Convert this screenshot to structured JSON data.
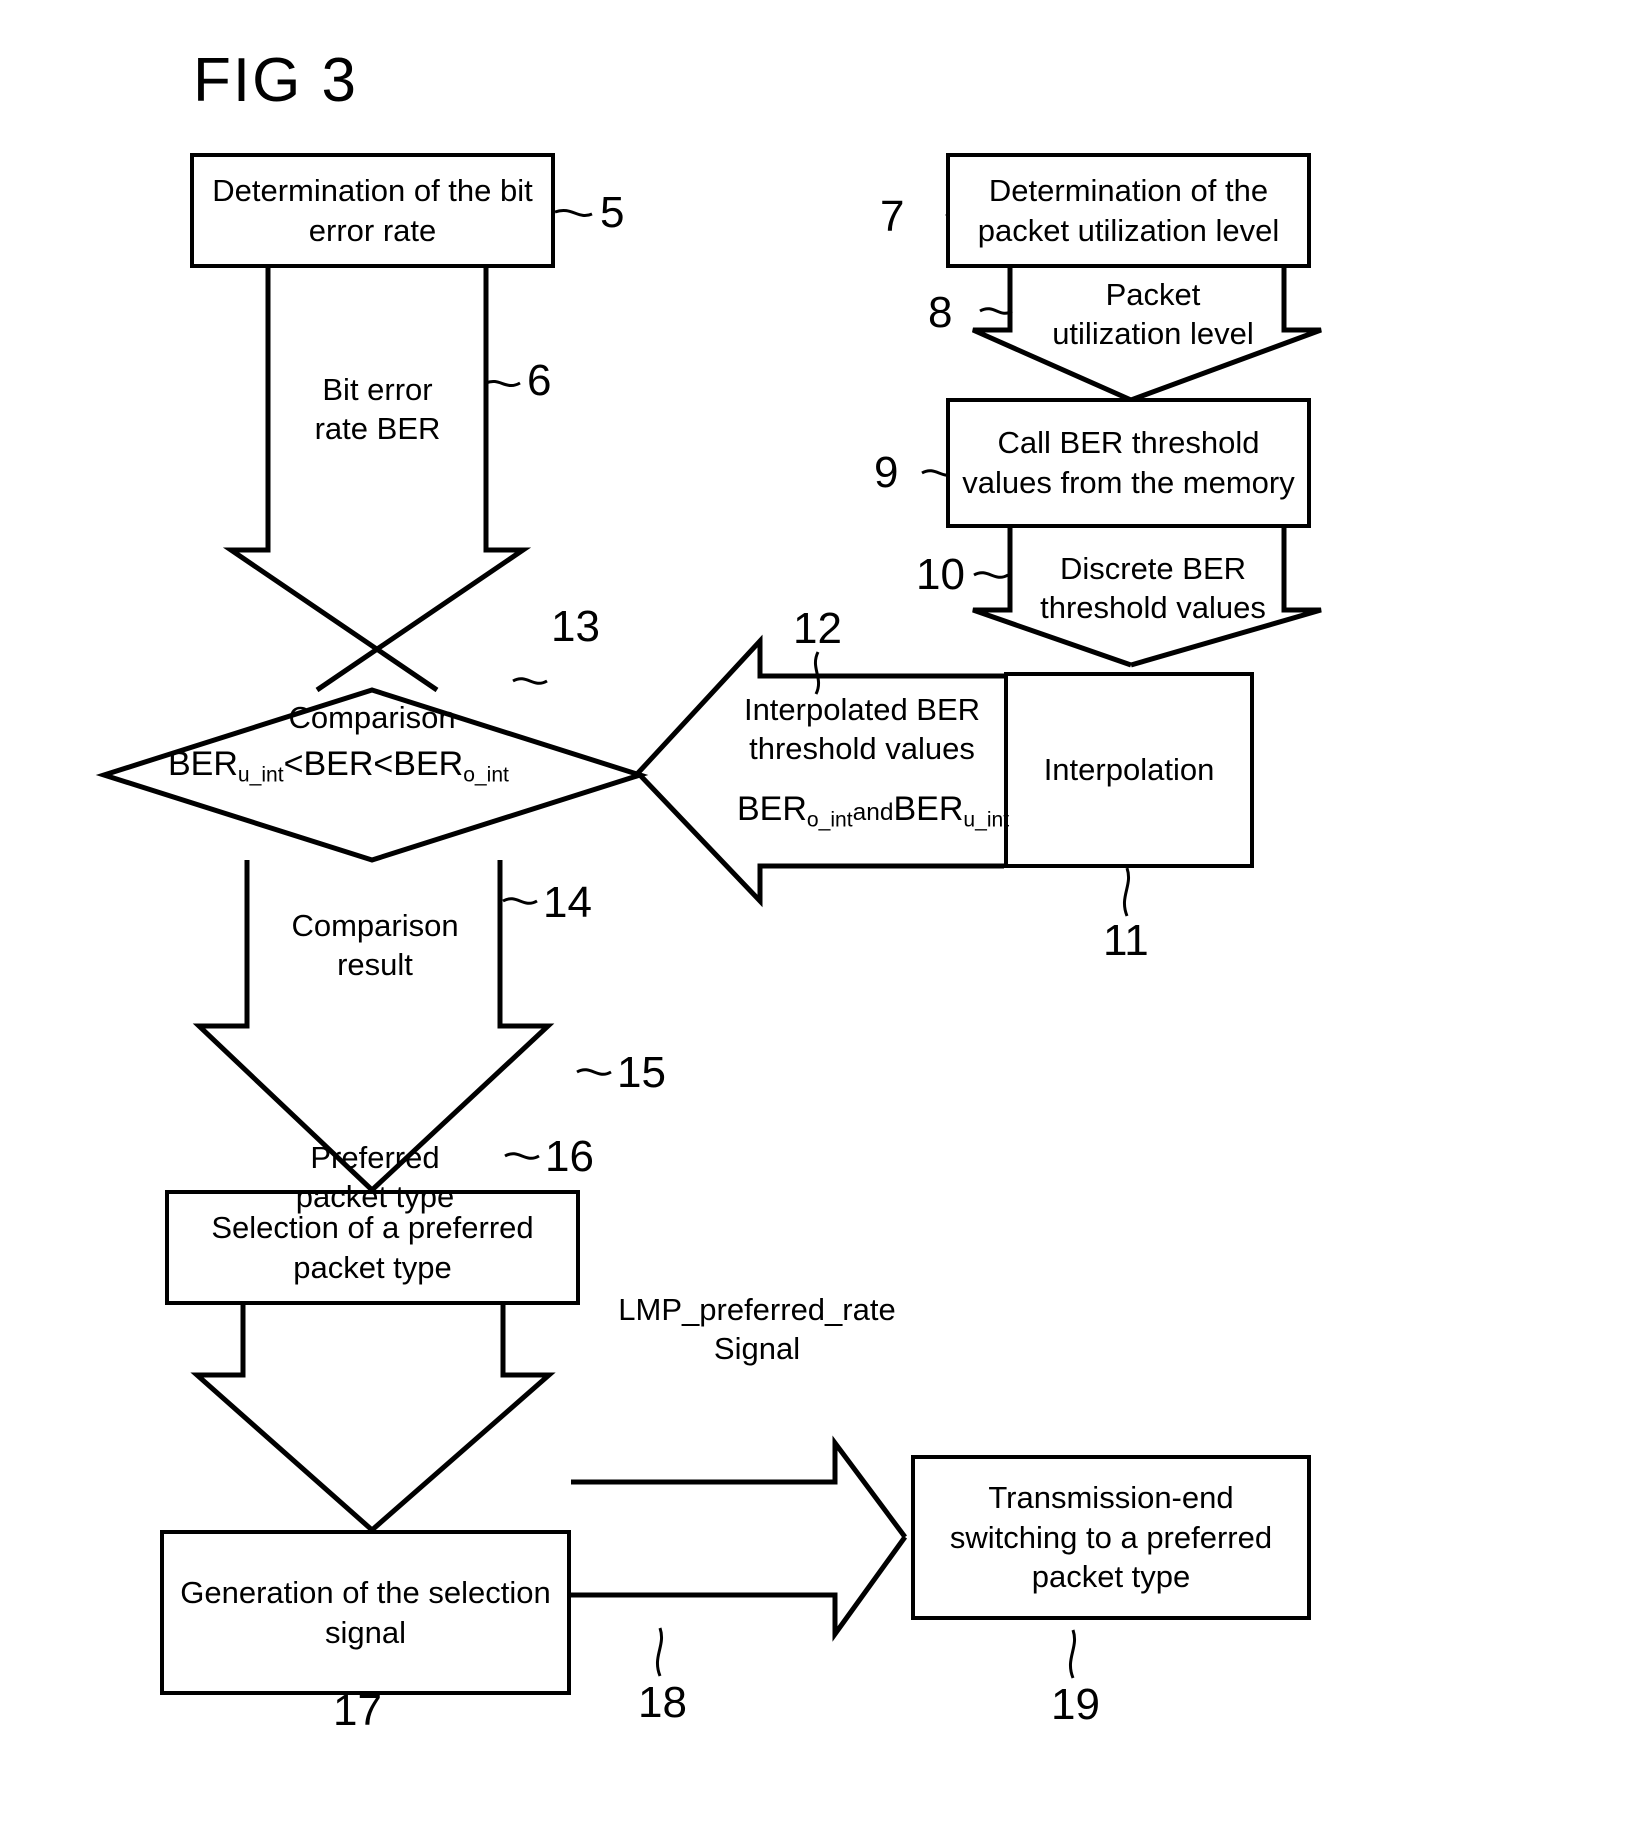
{
  "figure": {
    "title": "FIG 3",
    "type": "patent-flowchart"
  },
  "boxes": {
    "ber_determination": "Determination of\nthe bit error rate",
    "packet_utilization_determination": "Determination of the\npacket utilization level",
    "call_ber_thresholds": "Call BER threshold\nvalues from the\nmemory",
    "interpolation": "Interpolation",
    "selection_preferred": "Selection of a preferred\npacket type",
    "generation_signal": "Generation of the\nselection signal",
    "transmission_switching": "Transmission-end\nswitching to a\npreferred packet type"
  },
  "arrow_labels": {
    "bit_error_rate": "Bit error\nrate BER",
    "packet_utilization_level": "Packet\nutilization level",
    "discrete_ber": "Discrete BER\nthreshold values",
    "interpolated_ber": "Interpolated BER\nthreshold values",
    "comparison_result": "Comparison\nresult",
    "preferred_packet_type": "Preferred\npacket type",
    "lmp_signal": "LMP_preferred_rate\nSignal"
  },
  "decision": {
    "label": "Comparison",
    "condition_parts": {
      "a_base": "BER",
      "a_sub": "u_int",
      "op1": "<",
      "b": "BER",
      "op2": "<",
      "c_base": "BER",
      "c_sub": "o_int"
    }
  },
  "interpolated_formula": {
    "first_base": "BER",
    "first_sub": "o_int",
    "conjunction": "and",
    "second_base": "BER",
    "second_sub": "u_int"
  },
  "reference_numerals": {
    "n5": "5",
    "n6": "6",
    "n7": "7",
    "n8": "8",
    "n9": "9",
    "n10": "10",
    "n11": "11",
    "n12": "12",
    "n13": "13",
    "n14": "14",
    "n15": "15",
    "n16": "16",
    "n17": "17",
    "n18": "18",
    "n19": "19"
  },
  "colors": {
    "ink": "#000000",
    "paper": "#ffffff"
  }
}
